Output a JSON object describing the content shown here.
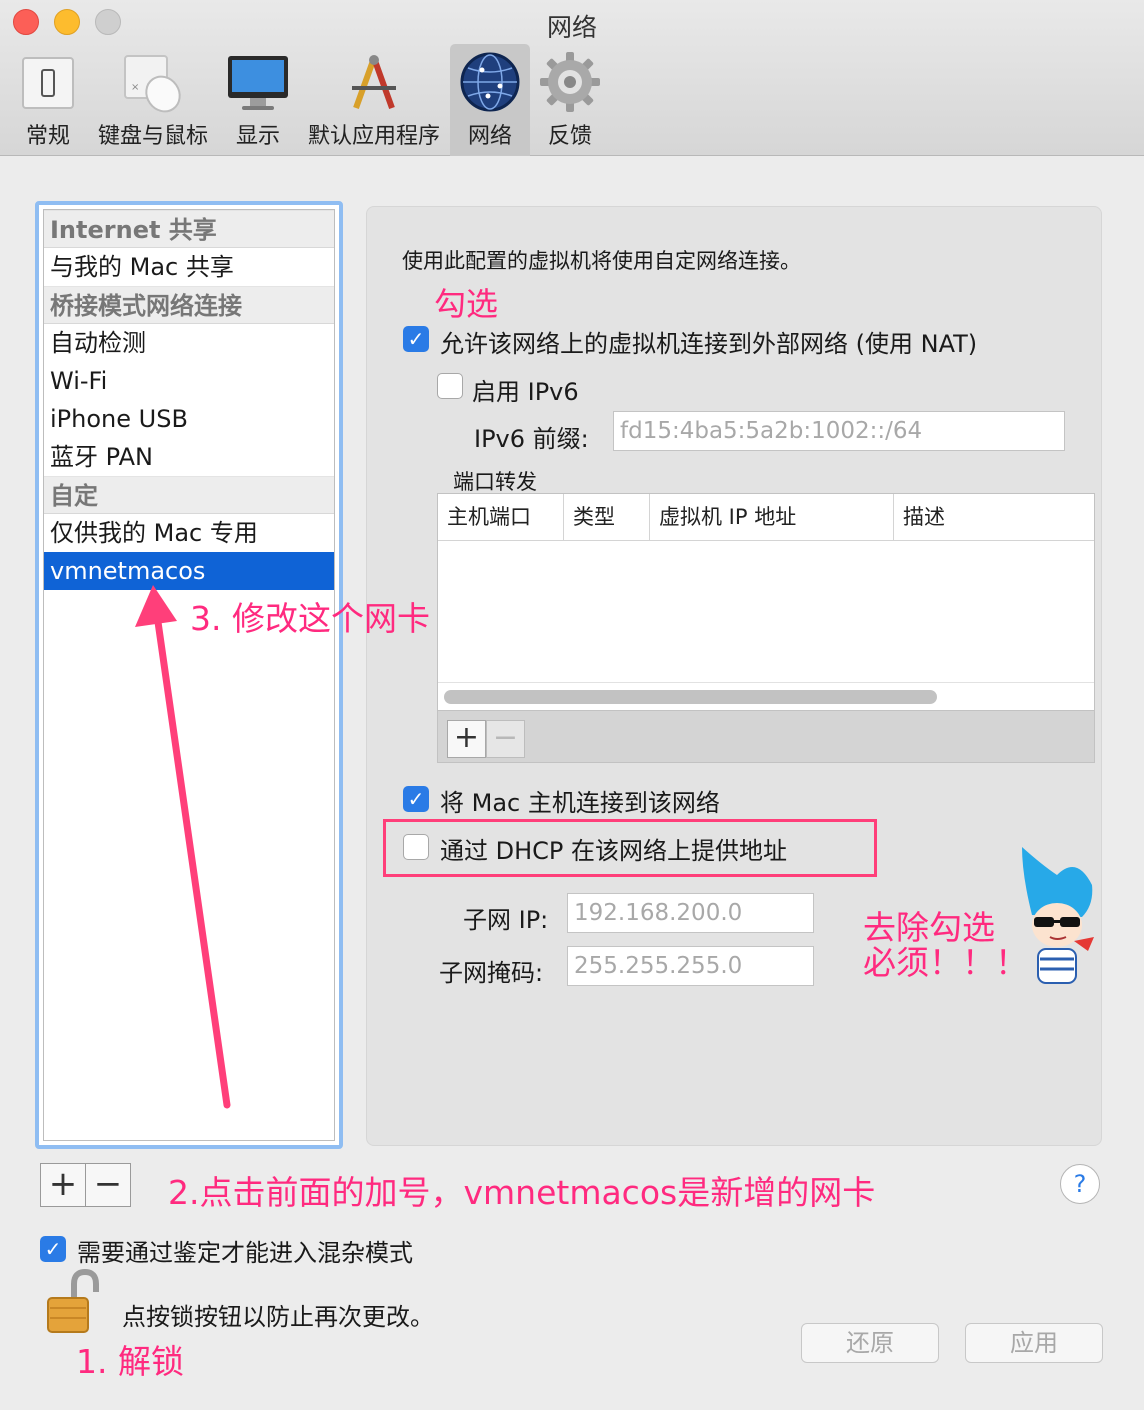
{
  "window": {
    "title": "网络"
  },
  "toolbar": {
    "items": [
      {
        "label": "常规"
      },
      {
        "label": "键盘与鼠标"
      },
      {
        "label": "显示"
      },
      {
        "label": "默认应用程序"
      },
      {
        "label": "网络"
      },
      {
        "label": "反馈"
      }
    ]
  },
  "network_list": {
    "items": [
      {
        "label": "Internet 共享",
        "type": "header"
      },
      {
        "label": "与我的 Mac 共享",
        "type": "item"
      },
      {
        "label": "桥接模式网络连接",
        "type": "header"
      },
      {
        "label": "自动检测",
        "type": "item"
      },
      {
        "label": "Wi-Fi",
        "type": "item"
      },
      {
        "label": "iPhone USB",
        "type": "item"
      },
      {
        "label": "蓝牙 PAN",
        "type": "item"
      },
      {
        "label": "自定",
        "type": "header"
      },
      {
        "label": "仅供我的 Mac 专用",
        "type": "item"
      },
      {
        "label": "vmnetmacos",
        "type": "selected"
      }
    ],
    "add_label": "+",
    "remove_label": "−"
  },
  "settings": {
    "description": "使用此配置的虚拟机将使用自定网络连接。",
    "nat": {
      "label": "允许该网络上的虚拟机连接到外部网络 (使用 NAT)",
      "checked": true
    },
    "ipv6": {
      "label": "启用 IPv6",
      "checked": false
    },
    "ipv6_prefix": {
      "label": "IPv6 前缀:",
      "value": "fd15:4ba5:5a2b:1002::/64"
    },
    "port_forwarding": {
      "title": "端口转发",
      "columns": [
        "主机端口",
        "类型",
        "虚拟机 IP 地址",
        "描述"
      ],
      "add_label": "+",
      "remove_label": "−"
    },
    "connect_host": {
      "label": "将 Mac 主机连接到该网络",
      "checked": true
    },
    "dhcp": {
      "label": "通过 DHCP 在该网络上提供地址",
      "checked": false
    },
    "subnet_ip": {
      "label": "子网 IP:",
      "value": "192.168.200.0"
    },
    "subnet_mask": {
      "label": "子网掩码:",
      "value": "255.255.255.0"
    }
  },
  "footer": {
    "promiscuous": {
      "label": "需要通过鉴定才能进入混杂模式",
      "checked": true
    },
    "lock_text": "点按锁按钮以防止再次更改。",
    "revert_label": "还原",
    "apply_label": "应用",
    "help_label": "?"
  },
  "annotations": {
    "check": "勾选",
    "modify": "3. 修改这个网卡",
    "add": "2.点击前面的加号，vmnetmacos是新增的网卡",
    "uncheck_line1": "去除勾选",
    "uncheck_line2": "必须！！！",
    "unlock": "1. 解锁"
  },
  "colors": {
    "accent": "#2a7be6",
    "selection": "#0f63d6",
    "annotation": "#ff2a7f",
    "list_border": "#8fbdf2"
  }
}
